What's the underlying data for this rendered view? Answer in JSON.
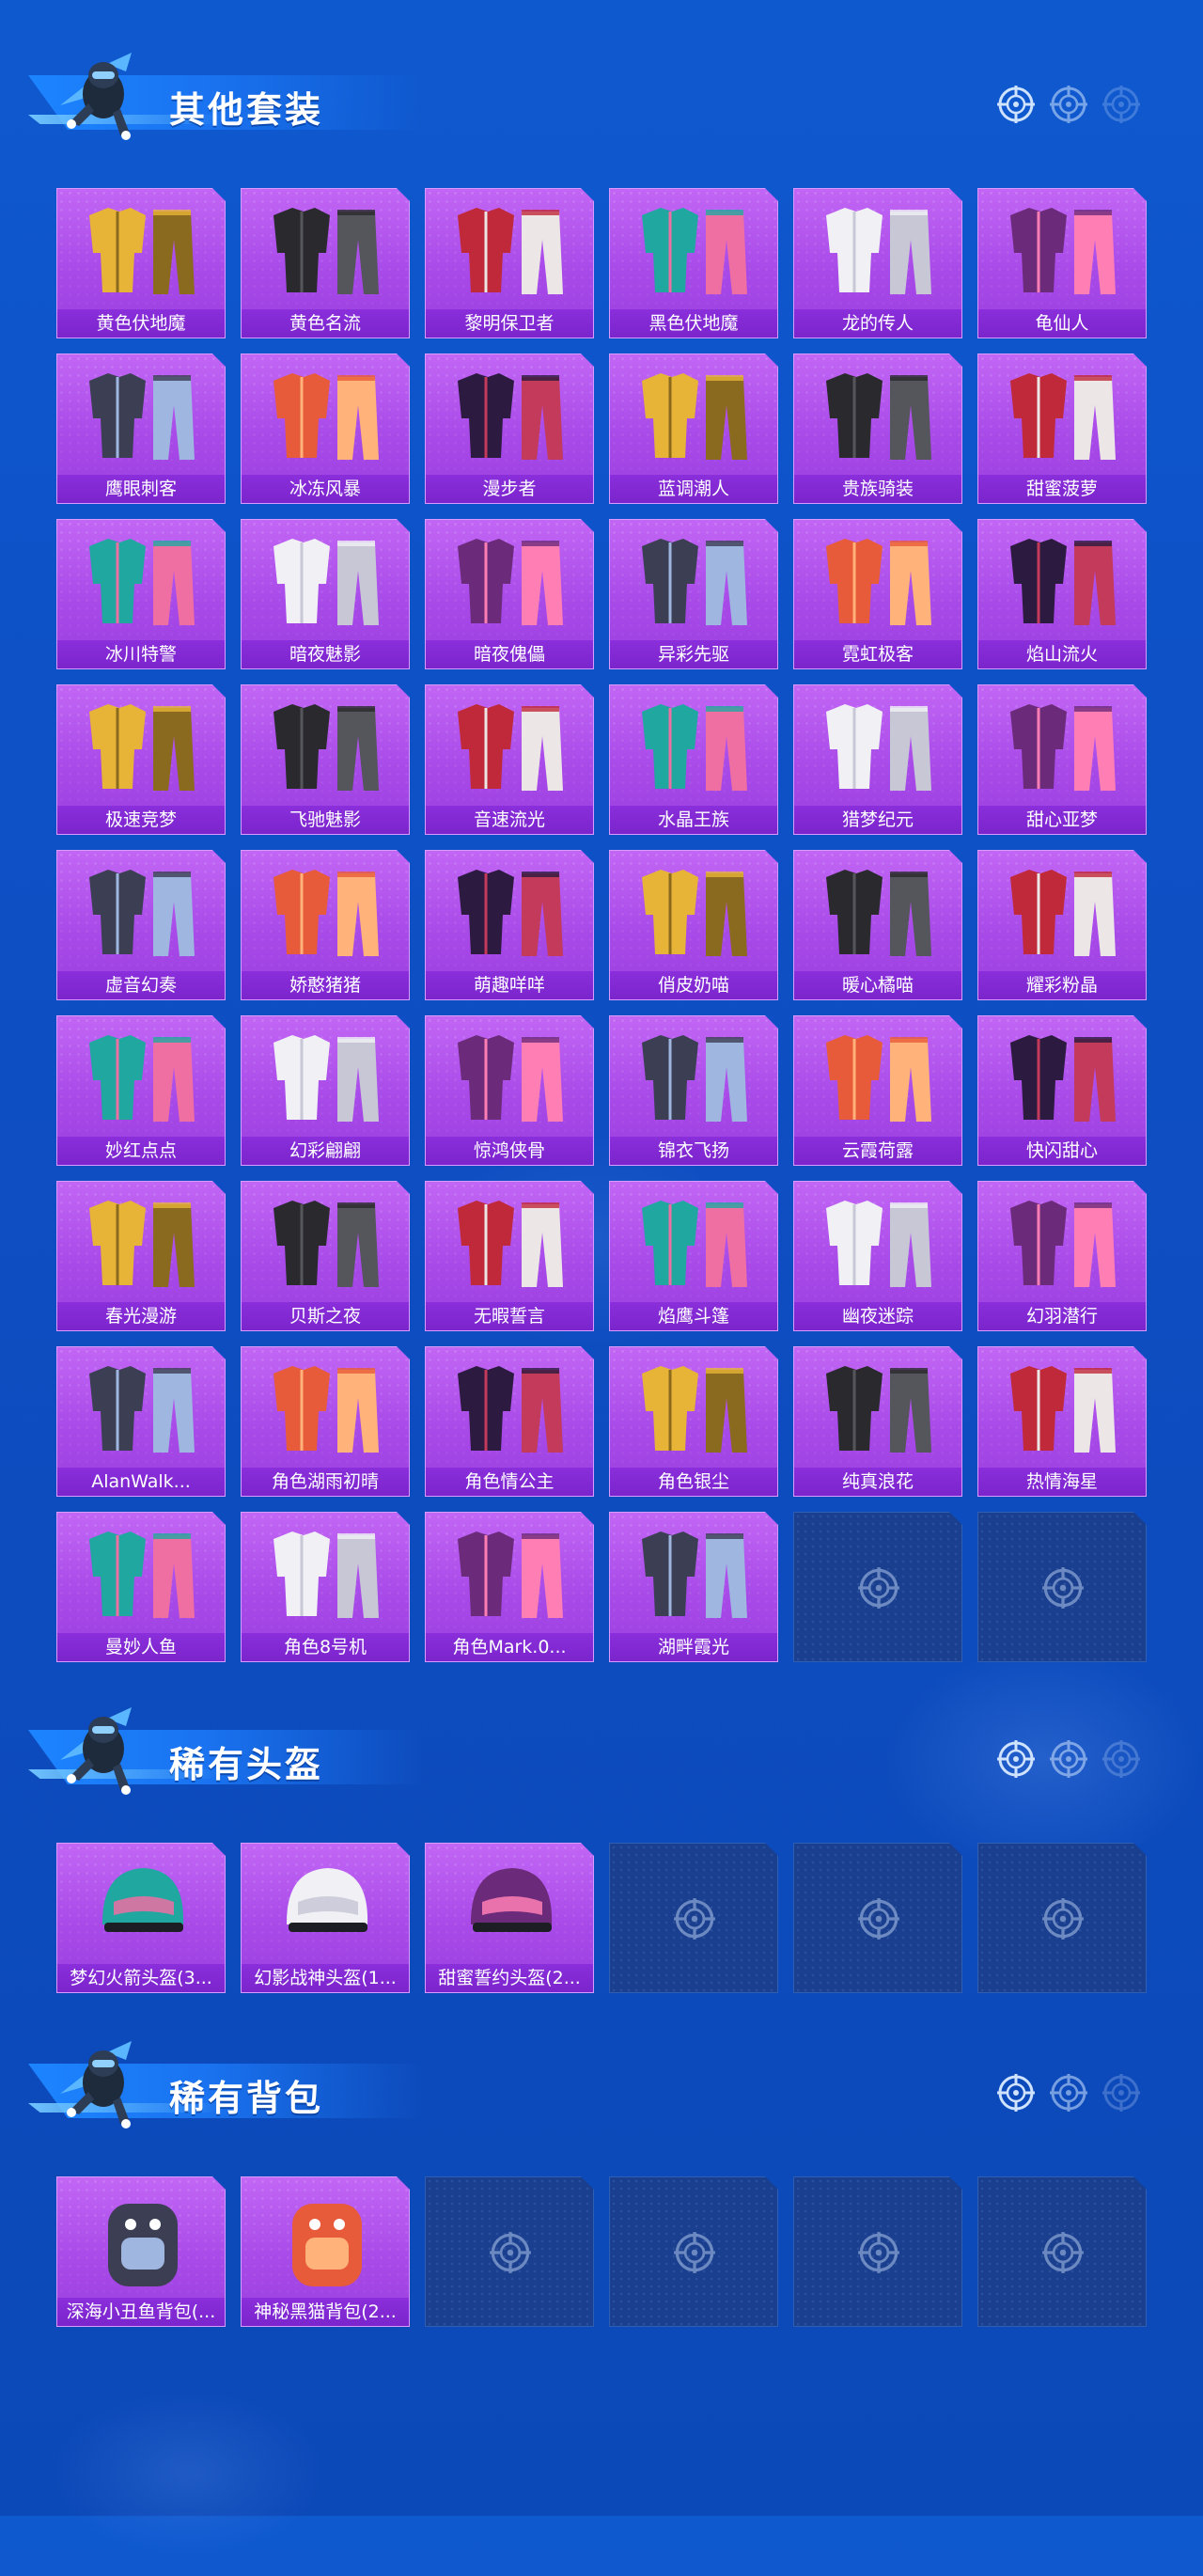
{
  "colors": {
    "background": "#0e50c6",
    "tile_purple": "#a84ae8",
    "tile_label": "#7b24cc",
    "tile_empty": "#1a3f8e",
    "title_text": "#ffffff"
  },
  "sections": [
    {
      "title": "其他套装",
      "icon": "target-icon",
      "items": [
        "黄色伏地魔",
        "黄色名流",
        "黎明保卫者",
        "黑色伏地魔",
        "龙的传人",
        "龟仙人",
        "鹰眼刺客",
        "冰冻风暴",
        "漫步者",
        "蓝调潮人",
        "贵族骑装",
        "甜蜜菠萝",
        "冰川特警",
        "暗夜魅影",
        "暗夜傀儡",
        "异彩先驱",
        "霓虹极客",
        "焰山流火",
        "极速竞梦",
        "飞驰魅影",
        "音速流光",
        "水晶王族",
        "猎梦纪元",
        "甜心亚梦",
        "虚音幻奏",
        "娇憨猪猪",
        "萌趣咩咩",
        "俏皮奶喵",
        "暖心橘喵",
        "耀彩粉晶",
        "妙红点点",
        "幻彩翩翩",
        "惊鸿侠骨",
        "锦衣飞扬",
        "云霞荷露",
        "快闪甜心",
        "春光漫游",
        "贝斯之夜",
        "无暇誓言",
        "焰鹰斗篷",
        "幽夜迷踪",
        "幻羽潜行",
        "AlanWalk...",
        "角色湖雨初晴",
        "角色情公主",
        "角色银尘",
        "纯真浪花",
        "热情海星",
        "曼妙人鱼",
        "角色8号机",
        "角色Mark.0...",
        "湖畔霞光"
      ],
      "empty_slots": 2
    },
    {
      "title": "稀有头盔",
      "icon": "target-icon",
      "items": [
        "梦幻火箭头盔(3...",
        "幻影战神头盔(1...",
        "甜蜜誓约头盔(2..."
      ],
      "empty_slots": 3
    },
    {
      "title": "稀有背包",
      "icon": "target-icon",
      "items": [
        "深海小丑鱼背包(...",
        "神秘黑猫背包(2..."
      ],
      "empty_slots": 4
    }
  ]
}
